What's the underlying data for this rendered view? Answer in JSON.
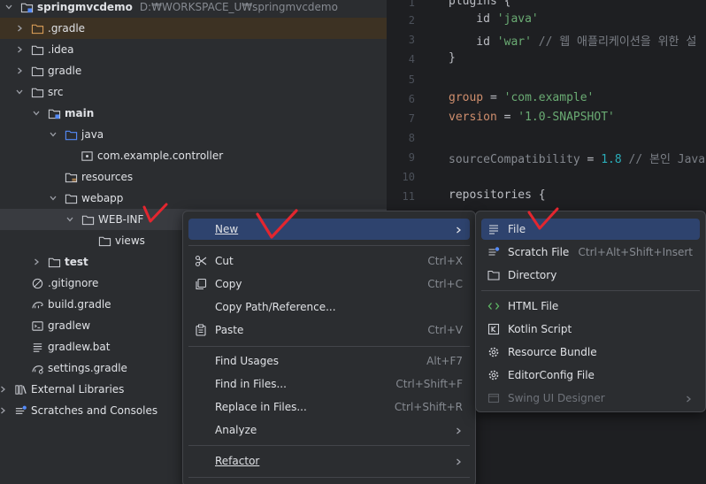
{
  "tree": {
    "root": {
      "label": "springmvcdemo",
      "path": "D:₩WORKSPACE_U₩springmvcdemo"
    },
    "items": [
      {
        "label": ".gradle"
      },
      {
        "label": ".idea"
      },
      {
        "label": "gradle"
      },
      {
        "label": "src"
      },
      {
        "label": "main"
      },
      {
        "label": "java"
      },
      {
        "label": "com.example.controller"
      },
      {
        "label": "resources"
      },
      {
        "label": "webapp"
      },
      {
        "label": "WEB-INF"
      },
      {
        "label": "views"
      },
      {
        "label": "test"
      },
      {
        "label": ".gitignore"
      },
      {
        "label": "build.gradle"
      },
      {
        "label": "gradlew"
      },
      {
        "label": "gradlew.bat"
      },
      {
        "label": "settings.gradle"
      },
      {
        "label": "External Libraries"
      },
      {
        "label": "Scratches and Consoles"
      }
    ]
  },
  "editor": {
    "line_numbers": [
      "1",
      "2",
      "3",
      "4",
      "5",
      "6",
      "7",
      "8",
      "9",
      "10",
      "11"
    ]
  },
  "context_menu": {
    "items": [
      {
        "label": "New",
        "shortcut": ""
      },
      {
        "label": "Cut",
        "shortcut": "Ctrl+X"
      },
      {
        "label": "Copy",
        "shortcut": "Ctrl+C"
      },
      {
        "label": "Copy Path/Reference...",
        "shortcut": ""
      },
      {
        "label": "Paste",
        "shortcut": "Ctrl+V"
      },
      {
        "label": "Find Usages",
        "shortcut": "Alt+F7"
      },
      {
        "label": "Find in Files...",
        "shortcut": "Ctrl+Shift+F"
      },
      {
        "label": "Replace in Files...",
        "shortcut": "Ctrl+Shift+R"
      },
      {
        "label": "Analyze",
        "shortcut": ""
      },
      {
        "label": "Refactor",
        "shortcut": ""
      }
    ]
  },
  "new_submenu": {
    "items": [
      {
        "label": "File",
        "shortcut": ""
      },
      {
        "label": "Scratch File",
        "shortcut": "Ctrl+Alt+Shift+Insert"
      },
      {
        "label": "Directory",
        "shortcut": ""
      },
      {
        "label": "HTML File",
        "shortcut": ""
      },
      {
        "label": "Kotlin Script",
        "shortcut": ""
      },
      {
        "label": "Resource Bundle",
        "shortcut": ""
      },
      {
        "label": "EditorConfig File",
        "shortcut": ""
      },
      {
        "label": "Swing UI Designer",
        "shortcut": ""
      }
    ]
  },
  "colors": {
    "tree_bg": "#2b2d30",
    "editor_bg": "#1e1f22",
    "menu_active": "#2e436e",
    "annotation_red": "#e3262f"
  }
}
